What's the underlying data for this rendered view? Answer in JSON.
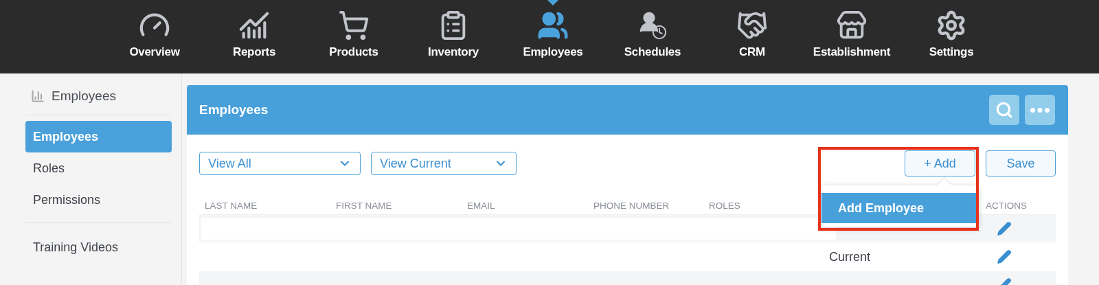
{
  "nav": [
    {
      "label": "Overview",
      "selected": false
    },
    {
      "label": "Reports",
      "selected": false
    },
    {
      "label": "Products",
      "selected": false
    },
    {
      "label": "Inventory",
      "selected": false
    },
    {
      "label": "Employees",
      "selected": true
    },
    {
      "label": "Schedules",
      "selected": false
    },
    {
      "label": "CRM",
      "selected": false
    },
    {
      "label": "Establishment",
      "selected": false
    },
    {
      "label": "Settings",
      "selected": false
    }
  ],
  "sidebar": {
    "title": "Employees",
    "items": [
      {
        "label": "Employees",
        "selected": true
      },
      {
        "label": "Roles",
        "selected": false
      },
      {
        "label": "Permissions",
        "selected": false
      }
    ],
    "extra_items": [
      {
        "label": "Training Videos",
        "selected": false
      }
    ]
  },
  "panel": {
    "title": "Employees",
    "filters": [
      {
        "value": "View All"
      },
      {
        "value": "View Current"
      }
    ],
    "add_button": "+ Add",
    "save_button": "Save",
    "add_menu": {
      "items": [
        {
          "label": "Add Employee",
          "highlighted": true
        }
      ]
    },
    "table": {
      "columns": [
        "LAST NAME",
        "FIRST NAME",
        "EMAIL",
        "PHONE NUMBER",
        "ROLES",
        "",
        "ACTIONS"
      ],
      "rows": [
        {
          "kind": "redacted"
        },
        {
          "kind": "plain",
          "status": "Current"
        },
        {
          "kind": "plain"
        }
      ]
    }
  }
}
